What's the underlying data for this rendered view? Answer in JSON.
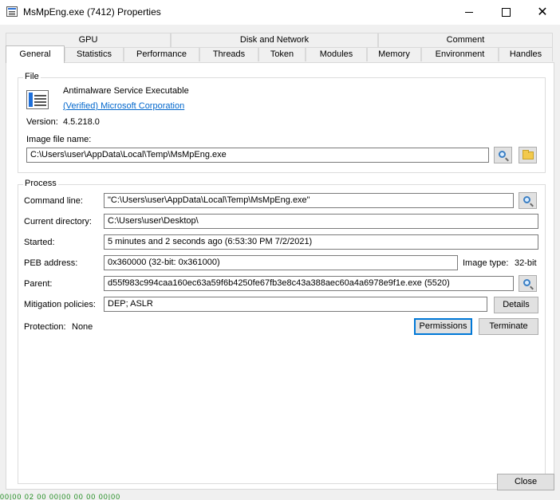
{
  "window": {
    "title": "MsMpEng.exe (7412) Properties",
    "controls": {
      "minimize": "minimize-icon",
      "maximize": "maximize-icon",
      "close": "close-icon"
    }
  },
  "tabs": {
    "row1": [
      "GPU",
      "Disk and Network",
      "Comment"
    ],
    "row2": [
      "General",
      "Statistics",
      "Performance",
      "Threads",
      "Token",
      "Modules",
      "Memory",
      "Environment",
      "Handles"
    ],
    "active": "General"
  },
  "file": {
    "legend": "File",
    "description": "Antimalware Service Executable",
    "company": "(Verified) Microsoft Corporation",
    "version_label": "Version:",
    "version": "4.5.218.0",
    "image_label": "Image file name:",
    "image_path": "C:\\Users\\user\\AppData\\Local\\Temp\\MsMpEng.exe",
    "icons": {
      "search": "magnifier-icon",
      "folder": "folder-icon",
      "app": "application-icon"
    }
  },
  "process": {
    "legend": "Process",
    "command_line_label": "Command line:",
    "command_line": "\"C:\\Users\\user\\AppData\\Local\\Temp\\MsMpEng.exe\"",
    "current_dir_label": "Current directory:",
    "current_dir": "C:\\Users\\user\\Desktop\\",
    "started_label": "Started:",
    "started": "5 minutes and 2 seconds ago (6:53:30 PM 7/2/2021)",
    "peb_label": "PEB address:",
    "peb": "0x360000 (32-bit: 0x361000)",
    "image_type_label": "Image type:",
    "image_type": "32-bit",
    "parent_label": "Parent:",
    "parent": "d55f983c994caa160ec63a59f6b4250fe67fb3e8c43a388aec60a4a6978e9f1e.exe (5520)",
    "mitigation_label": "Mitigation policies:",
    "mitigation": "DEP; ASLR",
    "details_button": "Details",
    "protection_label": "Protection:",
    "protection": "None",
    "permissions_button": "Permissions",
    "terminate_button": "Terminate"
  },
  "footer": {
    "close_button": "Close",
    "background_strip": "00|00 02 00 00|00 00 00 00|00"
  },
  "colors": {
    "accent": "#0078d7",
    "link": "#0066cc",
    "dialog_bg": "#f0f0f0"
  }
}
